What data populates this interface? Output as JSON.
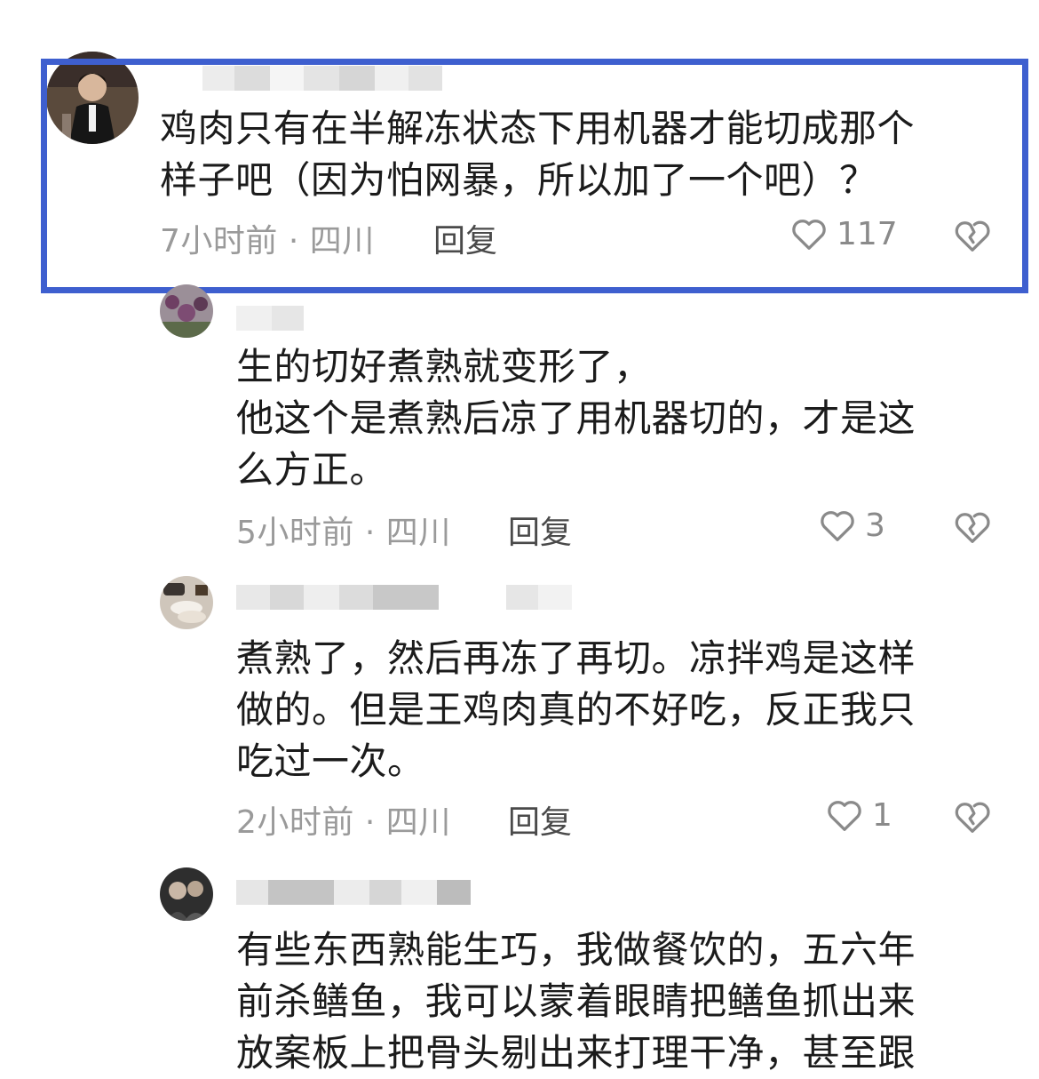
{
  "comments": [
    {
      "text_lines": [
        "鸡肉只有在半解冻状态下用机器才能切成那个",
        "样子吧（因为怕网暴，所以加了一个吧）？"
      ],
      "time": "7小时前 · 四川",
      "reply_label": "回复",
      "likes": "117"
    },
    {
      "text_lines": [
        "生的切好煮熟就变形了，",
        "他这个是煮熟后凉了用机器切的，才是这",
        "么方正。"
      ],
      "time": "5小时前 · 四川",
      "reply_label": "回复",
      "likes": "3"
    },
    {
      "text_lines": [
        "煮熟了，然后再冻了再切。凉拌鸡是这样",
        "做的。但是王鸡肉真的不好吃，反正我只",
        "吃过一次。"
      ],
      "time": "2小时前 · 四川",
      "reply_label": "回复",
      "likes": "1"
    },
    {
      "text_lines": [
        "有些东西熟能生巧，我做餐饮的，五六年",
        "前杀鳝鱼，我可以蒙着眼睛把鳝鱼抓出来",
        "放案板上把骨头剔出来打理干净，甚至跟"
      ]
    }
  ],
  "icons": {
    "like": "heart-outline-icon",
    "dislike": "broken-heart-icon"
  },
  "colors": {
    "highlight_border": "#3e5fcf",
    "meta_text": "#9a9a9a"
  }
}
